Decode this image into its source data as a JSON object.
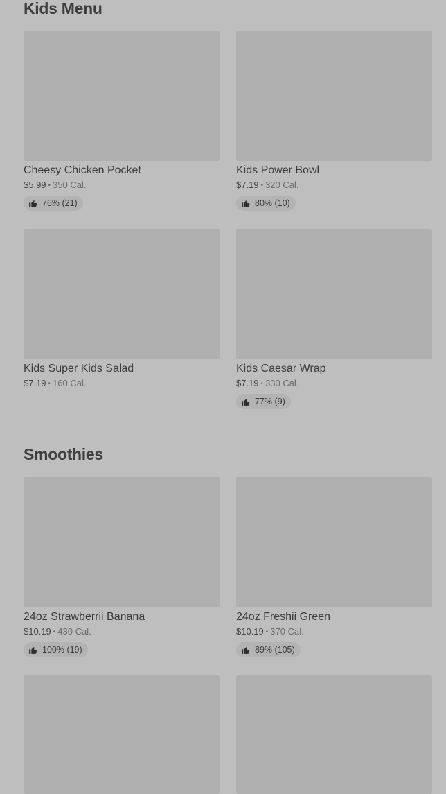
{
  "sections": [
    {
      "title": "Kids Menu",
      "items": [
        {
          "name": "Cheesy Chicken Pocket",
          "price": "$5.99",
          "calories": "350 Cal.",
          "rating": "76% (21)"
        },
        {
          "name": "Kids Power Bowl",
          "price": "$7.19",
          "calories": "320 Cal.",
          "rating": "80% (10)"
        },
        {
          "name": "Kids Super Kids Salad",
          "price": "$7.19",
          "calories": "160 Cal.",
          "rating": null
        },
        {
          "name": "Kids Caesar Wrap",
          "price": "$7.19",
          "calories": "330 Cal.",
          "rating": "77% (9)"
        }
      ]
    },
    {
      "title": "Smoothies",
      "items": [
        {
          "name": "24oz Strawberrii Banana",
          "price": "$10.19",
          "calories": "430 Cal.",
          "rating": "100% (19)"
        },
        {
          "name": "24oz Freshii Green",
          "price": "$10.19",
          "calories": "370 Cal.",
          "rating": "89% (105)"
        }
      ]
    }
  ],
  "separator": "•",
  "icons": {
    "rating": "thumbs-up-icon"
  },
  "colors": {
    "background": "#bebebe",
    "placeholder": "#afafaf",
    "rating_pill": "#b3b3b3"
  }
}
